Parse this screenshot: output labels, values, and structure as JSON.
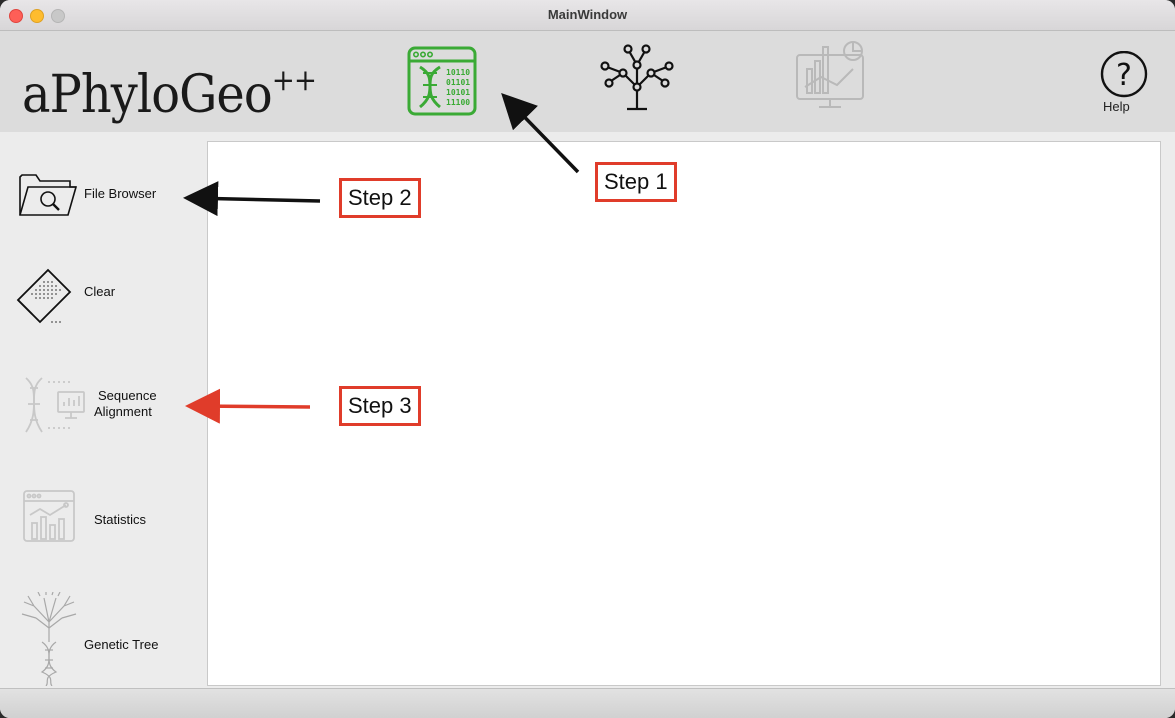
{
  "window": {
    "title": "MainWindow"
  },
  "header": {
    "logo_text": "aPhyloGeo",
    "logo_sup": "++",
    "help_label": "Help"
  },
  "sidebar": {
    "items": [
      {
        "label": "File Browser",
        "icon": "folder-search-icon"
      },
      {
        "label": "Clear",
        "icon": "eraser-icon"
      },
      {
        "label_line1": "Sequence",
        "label_line2": "Alignment",
        "icon": "dna-alignment-icon"
      },
      {
        "label": "Statistics",
        "icon": "statistics-chart-icon"
      },
      {
        "label": "Genetic Tree",
        "icon": "genetic-tree-icon"
      }
    ]
  },
  "annotations": {
    "step1": "Step 1",
    "step2": "Step 2",
    "step3": "Step 3"
  },
  "colors": {
    "accent_green": "#3aaa35",
    "annotation_red": "#e03c2a"
  }
}
